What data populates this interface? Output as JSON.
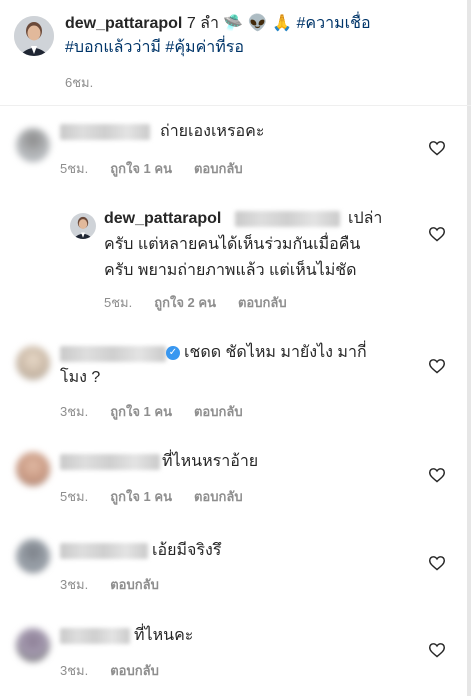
{
  "post": {
    "username": "dew_pattarapol",
    "caption": "7 ลำ 🛸 👽 🙏",
    "hashtags": [
      "#ความเชื่อ",
      "#บอกแล้วว่ามี",
      "#คุ้มค่าที่รอ"
    ],
    "time": "6ชม."
  },
  "comments": [
    {
      "text": "ถ่ายเองเหรอคะ",
      "time": "5ชม.",
      "likes": "ถูกใจ 1 คน",
      "reply": "ตอบกลับ"
    },
    {
      "username": "dew_pattarapol",
      "text_line1": "เปล่า",
      "text_line2": "ครับ แต่หลายคนได้เห็นร่วมกันเมื่อคืน",
      "text_line3": "ครับ พยามถ่ายภาพแล้ว แต่เห็นไม่ชัด",
      "time": "5ชม.",
      "likes": "ถูกใจ 2 คน",
      "reply": "ตอบกลับ"
    },
    {
      "text_line1": "เชดด ชัดไหม มายังไง มากี่",
      "text_line2": "โมง ?",
      "time": "3ชม.",
      "likes": "ถูกใจ 1 คน",
      "reply": "ตอบกลับ"
    },
    {
      "text": "ที่ไหนหราอ้าย",
      "time": "5ชม.",
      "likes": "ถูกใจ 1 คน",
      "reply": "ตอบกลับ"
    },
    {
      "text": "เอ้ยมีจริงรึ",
      "time": "3ชม.",
      "reply": "ตอบกลับ"
    },
    {
      "text": "ที่ไหนคะ",
      "time": "3ชม.",
      "reply": "ตอบกลับ"
    }
  ],
  "icons": {
    "like": "heart-outline-icon",
    "verified": "verified-badge-icon"
  }
}
